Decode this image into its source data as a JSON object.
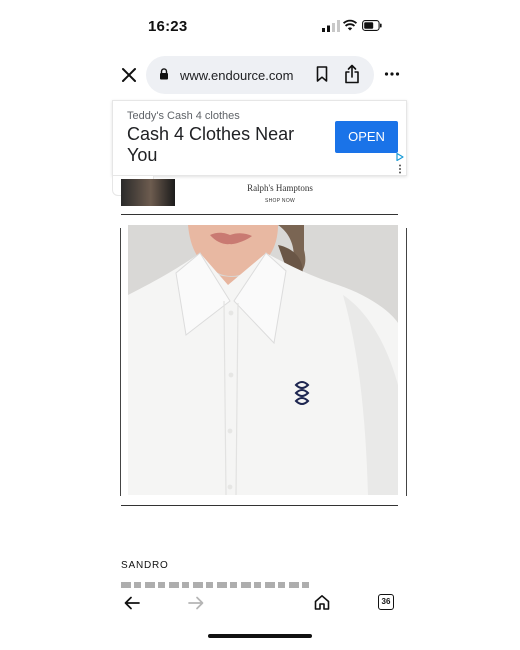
{
  "status_bar": {
    "time": "16:23"
  },
  "browser": {
    "url": "www.endource.com",
    "icons": [
      "close-icon",
      "lock-icon",
      "bookmark-icon",
      "share-icon",
      "more-icon"
    ]
  },
  "ad": {
    "advertiser": "Teddy's Cash 4 clothes",
    "headline": "Cash 4 Clothes Near You",
    "cta": "OPEN",
    "accent": "#1a73e8"
  },
  "banner": {
    "brand": "Ralph's Hamptons",
    "cta": "SHOP NOW"
  },
  "product": {
    "brand": "SANDRO"
  },
  "toolbar": {
    "tab_count": "36",
    "icons": [
      "back-arrow-icon",
      "forward-arrow-icon",
      "home-icon",
      "tabs-icon"
    ]
  }
}
